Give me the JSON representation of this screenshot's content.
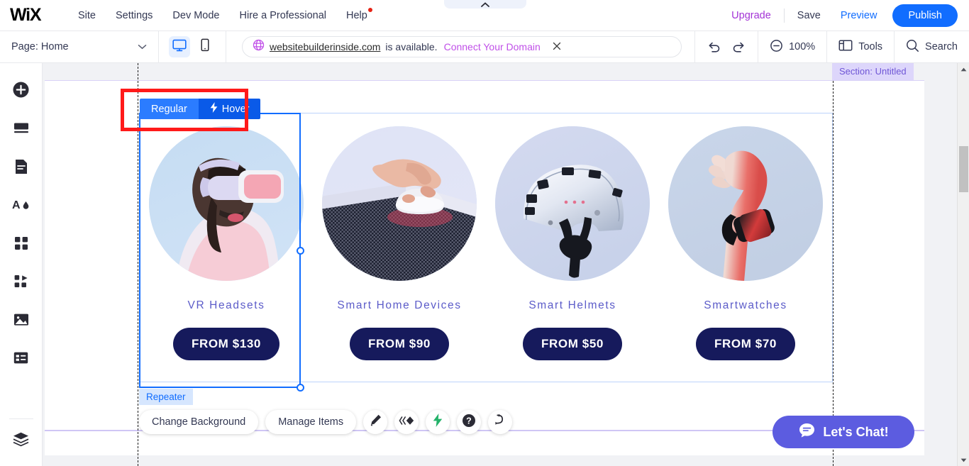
{
  "app": {
    "logo": "WiX",
    "collapse_tab_icon": "chevron-up-icon"
  },
  "topnav": {
    "items": [
      {
        "label": "Site"
      },
      {
        "label": "Settings"
      },
      {
        "label": "Dev Mode"
      },
      {
        "label": "Hire a Professional"
      },
      {
        "label": "Help",
        "badge": true
      }
    ],
    "upgrade": "Upgrade",
    "save": "Save",
    "preview": "Preview",
    "publish": "Publish"
  },
  "toolbar": {
    "page_label": "Page: Home",
    "page_chevron_icon": "chevron-down-icon",
    "viewport": {
      "desktop_icon": "desktop-icon",
      "mobile_icon": "mobile-icon",
      "active": "desktop"
    },
    "domain": {
      "globe_icon": "globe-icon",
      "name": "websitebuilderinside.com",
      "status_text": "is available.",
      "cta": "Connect Your Domain",
      "close_icon": "close-icon"
    },
    "undo_icon": "undo-icon",
    "redo_icon": "redo-icon",
    "zoom_icon": "zoom-out-icon",
    "zoom_level": "100%",
    "tools_icon": "panels-icon",
    "tools_label": "Tools",
    "search_icon": "search-icon",
    "search_label": "Search"
  },
  "sidebar": {
    "items": [
      {
        "name": "add-elements",
        "icon": "plus-circle-icon"
      },
      {
        "name": "add-section",
        "icon": "section-icon"
      },
      {
        "name": "pages-menu",
        "icon": "page-icon"
      },
      {
        "name": "site-design",
        "icon": "theme-icon"
      },
      {
        "name": "apps",
        "icon": "apps-grid-icon"
      },
      {
        "name": "app-market",
        "icon": "puzzle-icon"
      },
      {
        "name": "media",
        "icon": "image-icon"
      },
      {
        "name": "cms",
        "icon": "database-icon"
      },
      {
        "name": "layers",
        "icon": "layers-icon"
      }
    ]
  },
  "canvas": {
    "section_tag": "Section: Untitled",
    "state_tabs": [
      {
        "label": "Regular",
        "active": true,
        "icon": null
      },
      {
        "label": "Hover",
        "active": false,
        "icon": "lightning-icon"
      }
    ],
    "repeater_label": "Repeater",
    "component_toolbar": {
      "change_background": "Change Background",
      "manage_items": "Manage Items",
      "icons": [
        {
          "name": "design-pen-icon"
        },
        {
          "name": "animation-icon"
        },
        {
          "name": "interactions-lightning-icon"
        },
        {
          "name": "help-icon"
        },
        {
          "name": "connect-data-icon"
        }
      ]
    },
    "chat": {
      "icon": "chat-bubble-icon",
      "label": "Let's Chat!"
    }
  },
  "products": [
    {
      "title": "VR Headsets",
      "price": "FROM $130",
      "image": "vr-headset-photo",
      "selected": true
    },
    {
      "title": "Smart Home Devices",
      "price": "FROM $90",
      "image": "smart-home-photo",
      "selected": false
    },
    {
      "title": "Smart Helmets",
      "price": "FROM $50",
      "image": "smart-helmet-photo",
      "selected": false
    },
    {
      "title": "Smartwatches",
      "price": "FROM $70",
      "image": "smartwatch-photo",
      "selected": false
    }
  ],
  "colors": {
    "accent_blue": "#116dff",
    "publish_blue": "#116dff",
    "upgrade_purple": "#a333d6",
    "domain_cta": "#c050e8",
    "price_navy": "#161a5c",
    "title_indigo": "#5c5cc9",
    "section_purple": "#6f56d6",
    "highlight_red": "#ff1a1a",
    "chat_indigo": "#5c5ce0"
  }
}
